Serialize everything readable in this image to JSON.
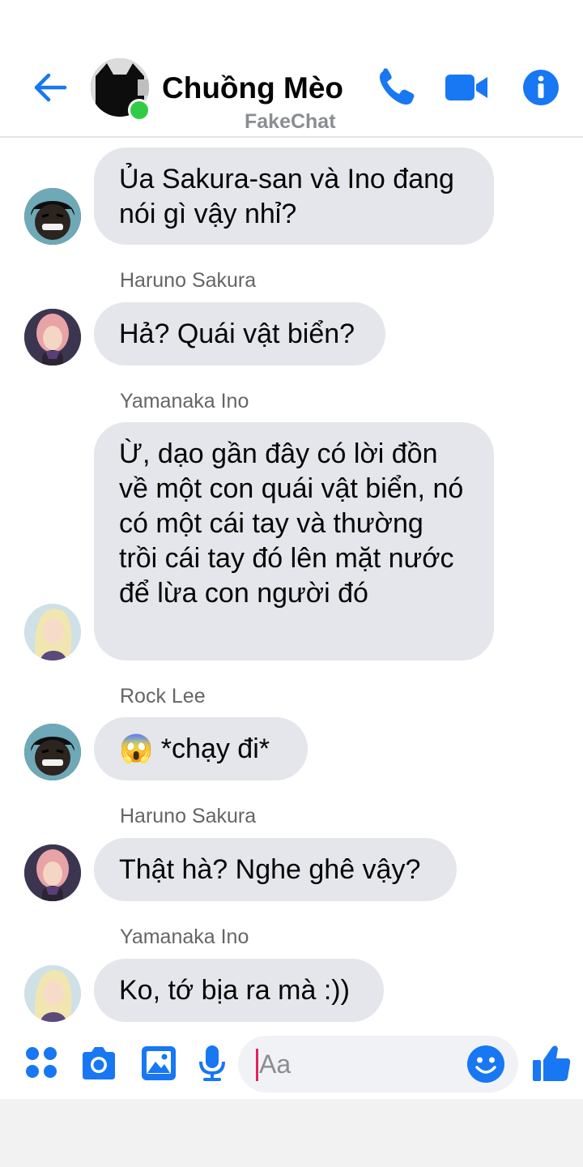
{
  "header": {
    "title": "Chuồng Mèo",
    "subtitle": "FakeChat",
    "accent_color": "#1877f2",
    "online_color": "#31cc46",
    "icons": [
      "back-arrow-icon",
      "phone-icon",
      "video-camera-icon",
      "info-icon"
    ]
  },
  "messages": [
    {
      "sender": "",
      "avatar": "rock-lee",
      "text": "Ủa Sakura-san và Ino đang nói gì vậy nhỉ?"
    },
    {
      "sender": "Haruno Sakura",
      "avatar": "haruno-sakura",
      "text": "Hả? Quái vật biển?"
    },
    {
      "sender": "Yamanaka Ino",
      "avatar": "yamanaka-ino",
      "text": "Ừ, dạo gần đây có lời đồn về một con quái vật biển, nó có một cái tay và thường trồi cái tay đó lên mặt nước để lừa con người đó"
    },
    {
      "sender": "Rock Lee",
      "avatar": "rock-lee",
      "emoji": "😱",
      "text": "*chạy đi*"
    },
    {
      "sender": "Haruno Sakura",
      "avatar": "haruno-sakura",
      "text": "Thật hà? Nghe ghê vậy?"
    },
    {
      "sender": "Yamanaka Ino",
      "avatar": "yamanaka-ino",
      "text": "Ko, tớ bịa ra mà :))"
    }
  ],
  "composer": {
    "placeholder": "Aa",
    "icons": [
      "apps-grid-icon",
      "camera-icon",
      "image-icon",
      "microphone-icon",
      "emoji-icon",
      "thumbs-up-icon"
    ]
  },
  "colors": {
    "bubble": "#e4e6eb",
    "sender_name": "#656565",
    "accent": "#1877f2"
  }
}
